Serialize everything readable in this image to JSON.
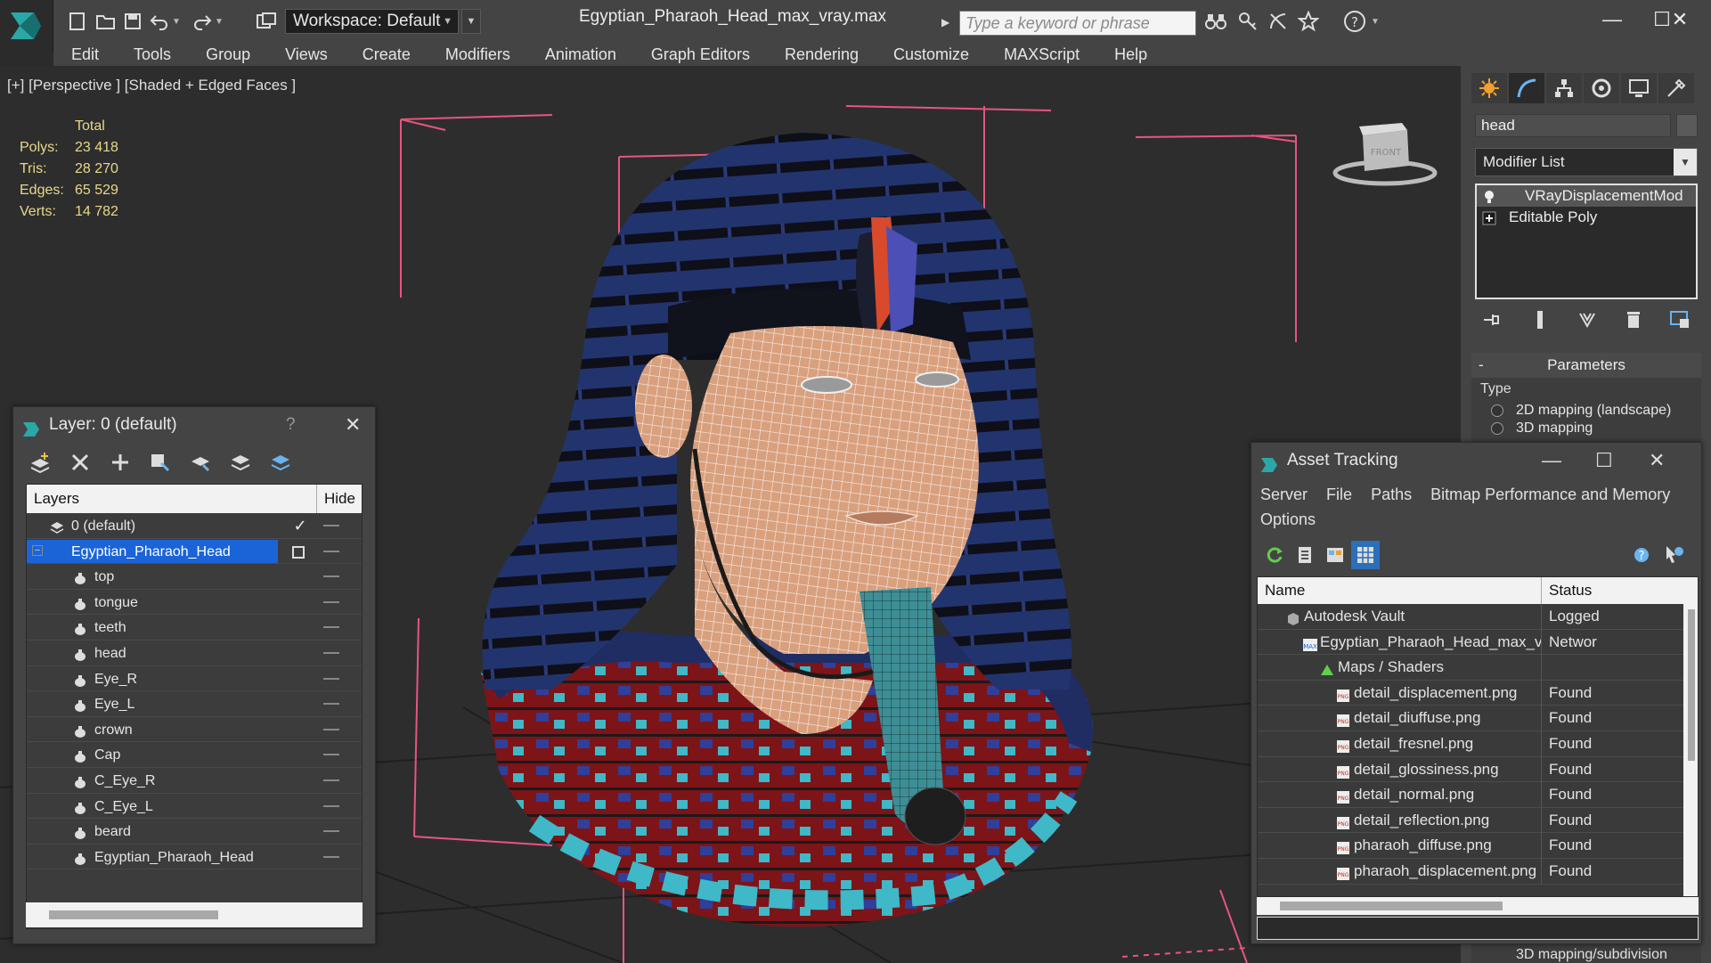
{
  "title_bar": {
    "workspace_label": "Workspace: Default",
    "file_title": "Egyptian_Pharaoh_Head_max_vray.max",
    "search_placeholder": "Type a keyword or phrase"
  },
  "menu": [
    "Edit",
    "Tools",
    "Group",
    "Views",
    "Create",
    "Modifiers",
    "Animation",
    "Graph Editors",
    "Rendering",
    "Customize",
    "MAXScript",
    "Help"
  ],
  "viewport": {
    "label": "[+] [Perspective ] [Shaded + Edged Faces ]",
    "stats_header": "Total",
    "stats": [
      {
        "label": "Polys:",
        "value": "23 418"
      },
      {
        "label": "Tris:",
        "value": "28 270"
      },
      {
        "label": "Edges:",
        "value": "65 529"
      },
      {
        "label": "Verts:",
        "value": "14 782"
      }
    ],
    "viewcube_face": "FRONT"
  },
  "command_panel": {
    "object_name": "head",
    "modifier_list": "Modifier List",
    "stack": [
      "VRayDisplacementMod",
      "Editable Poly"
    ],
    "params_title": "Parameters",
    "type_label": "Type",
    "options": [
      "2D mapping (landscape)",
      "3D mapping"
    ],
    "footer": "3D mapping/subdivision"
  },
  "layer_panel": {
    "title": "Layer: 0 (default)",
    "help": "?",
    "col_layers": "Layers",
    "col_hide": "Hide",
    "rows": [
      {
        "name": "0 (default)"
      },
      {
        "name": "Egyptian_Pharaoh_Head"
      },
      {
        "name": "top"
      },
      {
        "name": "tongue"
      },
      {
        "name": "teeth"
      },
      {
        "name": "head"
      },
      {
        "name": "Eye_R"
      },
      {
        "name": "Eye_L"
      },
      {
        "name": "crown"
      },
      {
        "name": "Cap"
      },
      {
        "name": "C_Eye_R"
      },
      {
        "name": "C_Eye_L"
      },
      {
        "name": "beard"
      },
      {
        "name": "Egyptian_Pharaoh_Head"
      }
    ]
  },
  "asset_panel": {
    "title": "Asset Tracking",
    "menu": [
      "Server",
      "File",
      "Paths",
      "Bitmap Performance and Memory",
      "Options"
    ],
    "col_name": "Name",
    "col_status": "Status",
    "rows": [
      {
        "name": "Autodesk Vault",
        "status": "Logged"
      },
      {
        "name": "Egyptian_Pharaoh_Head_max_vray.max",
        "status": "Networ"
      },
      {
        "name": "Maps / Shaders",
        "status": ""
      },
      {
        "name": "detail_displacement.png",
        "status": "Found"
      },
      {
        "name": "detail_diuffuse.png",
        "status": "Found"
      },
      {
        "name": "detail_fresnel.png",
        "status": "Found"
      },
      {
        "name": "detail_glossiness.png",
        "status": "Found"
      },
      {
        "name": "detail_normal.png",
        "status": "Found"
      },
      {
        "name": "detail_reflection.png",
        "status": "Found"
      },
      {
        "name": "pharaoh_diffuse.png",
        "status": "Found"
      },
      {
        "name": "pharaoh_displacement.png",
        "status": "Found"
      }
    ]
  },
  "colors": {
    "selection": "#1b64d8",
    "stats_text": "#e8d98a",
    "bounding_box": "#e7557f",
    "headdress_blue": "#22346e",
    "skin_wire": "#f2ddd2"
  }
}
